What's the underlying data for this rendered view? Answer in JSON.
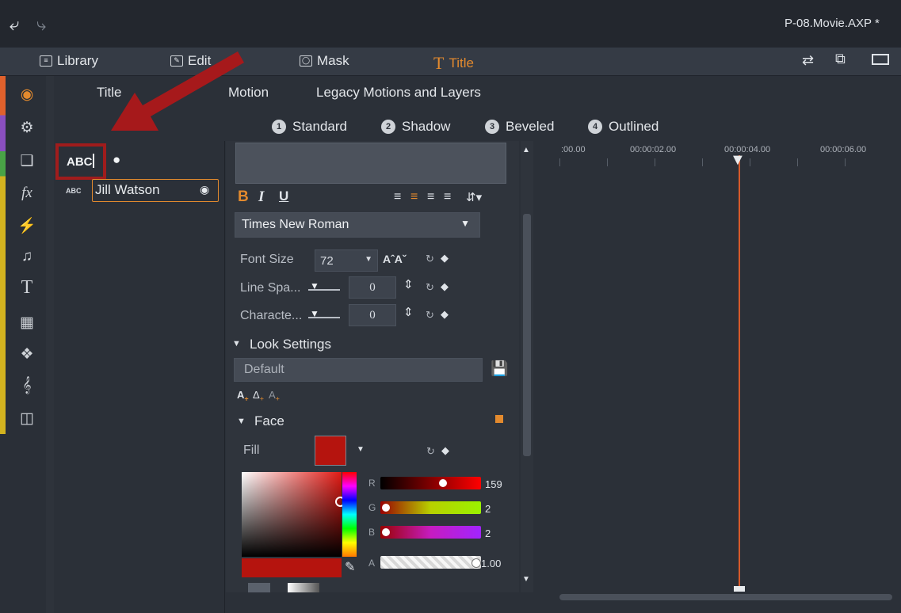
{
  "window": {
    "project_name": "P-08.Movie.AXP *"
  },
  "main_tabs": [
    {
      "label": "Library"
    },
    {
      "label": "Edit"
    },
    {
      "label": "Mask"
    },
    {
      "label": "Title"
    }
  ],
  "sub_tabs": {
    "title": "Title",
    "motion": "Motion",
    "legacy": "Legacy Motions and Layers"
  },
  "styles": [
    {
      "num": "1",
      "label": "Standard"
    },
    {
      "num": "2",
      "label": "Shadow"
    },
    {
      "num": "3",
      "label": "Beveled"
    },
    {
      "num": "4",
      "label": "Outlined"
    }
  ],
  "layers": {
    "abc_label": "ABC",
    "item_tag": "ABC",
    "item_name": "Jill Watson"
  },
  "format": {
    "bold": "B",
    "italic": "I",
    "underline": "U",
    "font_family": "Times New Roman",
    "font_size_label": "Font Size",
    "font_size_value": "72",
    "line_spacing_label": "Line Spa...",
    "line_spacing_value": "0",
    "char_spacing_label": "Characte...",
    "char_spacing_value": "0"
  },
  "look": {
    "section_label": "Look Settings",
    "preset": "Default",
    "face_label": "Face",
    "fill_label": "Fill",
    "fill_color": "#b5140e"
  },
  "color_picker": {
    "r_label": "R",
    "r_value": "159",
    "g_label": "G",
    "g_value": "2",
    "b_label": "B",
    "b_value": "2",
    "a_label": "A",
    "a_value": "1.00"
  },
  "timeline": {
    "ticks": [
      ":00.00",
      "00:00:02.00",
      "00:00:04.00",
      "00:00:06.00"
    ]
  },
  "colors": {
    "accent": "#e38a2e",
    "highlight_box": "#a01c1c",
    "arrow": "#a6191b",
    "playhead": "#d65a2a"
  }
}
